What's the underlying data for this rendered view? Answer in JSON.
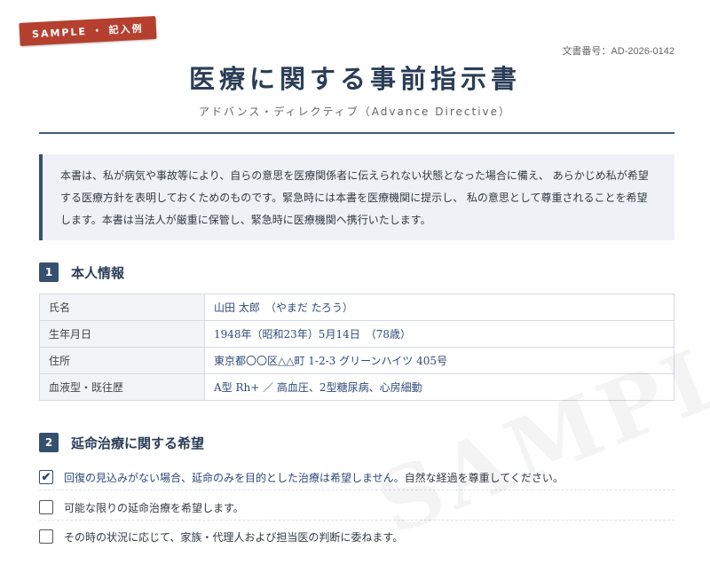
{
  "stamp": "SAMPLE ・ 記入例",
  "document_number": "文書番号：AD-2026-0142",
  "title": "医療に関する事前指示書",
  "subtitle": "アドバンス・ディレクティブ（Advance Directive）",
  "intro_lines": [
    "本書は、私が病気や事故等により、自らの意思を医療関係者に伝えられない状態となった場合に備え、 あらかじめ私が希望",
    "する医療方針を表明しておくためのものです。緊急時には本書を医療機関に提示し、 私の意思として尊重されることを希望",
    "します。本書は当法人が厳重に保管し、緊急時に医療機関へ携行いたします。"
  ],
  "section1": {
    "number": "1",
    "title": "本人情報",
    "rows": [
      {
        "label": "氏名",
        "value": "山田 太郎　（やまだ たろう）"
      },
      {
        "label": "生年月日",
        "value": "1948年（昭和23年）5月14日　（78歳）"
      },
      {
        "label": "住所",
        "value": "東京都〇〇区△△町 1-2-3 グリーンハイツ 405号"
      },
      {
        "label": "血液型・既往歴",
        "value": "A型 Rh+ ／ 高血圧、2型糖尿病、心房細動"
      }
    ]
  },
  "section2": {
    "number": "2",
    "title": "延命治療に関する希望",
    "options": [
      {
        "checked": true,
        "check_mark": "✔",
        "text_selected": "回復の見込みがない場合、延命のみを目的とした治療は希望しません。",
        "text_rest": "自然な経過を尊重してください。"
      },
      {
        "checked": false,
        "check_mark": "",
        "text_selected": "",
        "text_rest": "可能な限りの延命治療を希望します。"
      },
      {
        "checked": false,
        "check_mark": "",
        "text_selected": "",
        "text_rest": "その時の状況に応じて、家族・代理人および担当医の判断に委ねます。"
      }
    ]
  },
  "watermark": "SAMPLE"
}
